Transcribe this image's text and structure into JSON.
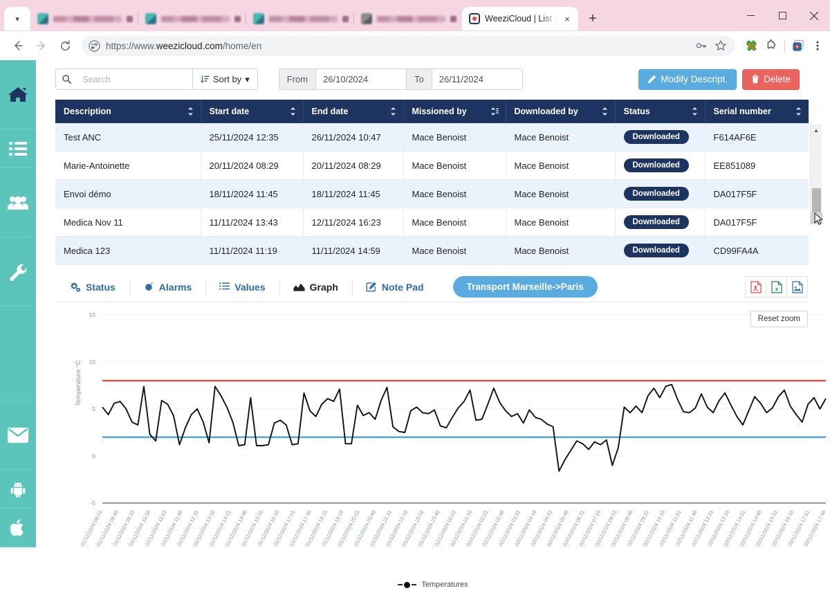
{
  "browser": {
    "tab_chevron_icon": "chevron-down-icon",
    "tabs": [
      {
        "title": "",
        "blurred": true
      },
      {
        "title": "",
        "blurred": true
      },
      {
        "title": "",
        "blurred": true
      },
      {
        "title": "",
        "blurred": true
      }
    ],
    "active_tab": {
      "title": "WeeziCloud | List of m",
      "favicon": "weezicloud-favicon",
      "close_label": "×"
    },
    "new_tab_label": "+",
    "window_controls": {
      "minimize": "—",
      "maximize": "□",
      "close": "✕"
    },
    "nav": {
      "back": "←",
      "forward": "→",
      "reload": "⟳"
    },
    "url_scheme": "https://www.",
    "url_host": "weezicloud.com",
    "url_path": "/home/en",
    "omnibox_icons": [
      "site-settings-icon",
      "password-key-icon",
      "bookmark-star-icon"
    ],
    "extension_icons": [
      "extension-5q-icon",
      "puzzle-extensions-icon",
      "profile-avatar-icon",
      "kebab-menu-icon"
    ]
  },
  "sidebar": {
    "items": [
      {
        "icon": "home-icon",
        "active": true
      },
      {
        "icon": "list-icon",
        "active": false
      },
      {
        "icon": "users-icon",
        "active": false
      },
      {
        "icon": "wrench-icon",
        "active": false
      },
      {
        "icon": "envelope-icon",
        "active": false
      },
      {
        "icon": "android-icon",
        "active": false
      },
      {
        "icon": "apple-icon",
        "active": false
      }
    ]
  },
  "toolbar": {
    "search_icon": "search-icon",
    "search_value": "",
    "search_placeholder": "Search",
    "sort_label": "Sort by",
    "sort_icon": "sort-icon",
    "sort_caret": "▾",
    "from_label": "From",
    "from_value": "26/10/2024",
    "to_label": "To",
    "to_value": "26/11/2024",
    "modify_label": "Modify Descript.",
    "modify_icon": "pencil-icon",
    "delete_label": "Delete",
    "delete_icon": "trash-icon",
    "accent_blue": "#5aabdf",
    "accent_red": "#e9645c"
  },
  "table": {
    "columns": [
      {
        "label": "Description",
        "sorted": false
      },
      {
        "label": "Start date",
        "sorted": false
      },
      {
        "label": "End date",
        "sorted": false
      },
      {
        "label": "Missioned by",
        "sorted": true
      },
      {
        "label": "Downloaded by",
        "sorted": false
      },
      {
        "label": "Status",
        "sorted": false
      },
      {
        "label": "Serial number",
        "sorted": false
      }
    ],
    "rows": [
      {
        "description": "Test ANC",
        "start": "25/11/2024 12:35",
        "end": "26/11/2024 10:47",
        "missioned": "Mace Benoist",
        "downloaded": "Mace Benoist",
        "status": "Downloaded",
        "serial": "F614AF6E"
      },
      {
        "description": "Marie-Antoinette",
        "start": "20/11/2024 08:29",
        "end": "20/11/2024 08:29",
        "missioned": "Mace Benoist",
        "downloaded": "Mace Benoist",
        "status": "Downloaded",
        "serial": "EE851089"
      },
      {
        "description": "Envoi démo",
        "start": "18/11/2024 11:45",
        "end": "18/11/2024 11:45",
        "missioned": "Mace Benoist",
        "downloaded": "Mace Benoist",
        "status": "Downloaded",
        "serial": "DA017F5F"
      },
      {
        "description": "Medica Nov 11",
        "start": "11/11/2024 13:43",
        "end": "12/11/2024 16:23",
        "missioned": "Mace Benoist",
        "downloaded": "Mace Benoist",
        "status": "Downloaded",
        "serial": "DA017F5F"
      },
      {
        "description": "Medica 123",
        "start": "11/11/2024 11:19",
        "end": "11/11/2024 14:59",
        "missioned": "Mace Benoist",
        "downloaded": "Mace Benoist",
        "status": "Downloaded",
        "serial": "CD99FA4A"
      }
    ],
    "header_bg": "#1d3461",
    "badge_bg": "#1d3461"
  },
  "detail_tabs": {
    "items": [
      {
        "label": "Status",
        "icon": "gears-icon",
        "active": false
      },
      {
        "label": "Alarms",
        "icon": "bell-icon",
        "active": false
      },
      {
        "label": "Values",
        "icon": "list-values-icon",
        "active": false
      },
      {
        "label": "Graph",
        "icon": "chart-icon",
        "active": true
      },
      {
        "label": "Note Pad",
        "icon": "notepad-edit-icon",
        "active": false
      }
    ],
    "mission_title": "Transport Marseille->Paris",
    "exports": [
      {
        "icon": "export-pdf-icon",
        "color": "#e8453c",
        "label": "PDF"
      },
      {
        "icon": "export-excel-icon",
        "color": "#1d8a4c",
        "label": "Excel"
      },
      {
        "icon": "export-image-icon",
        "color": "#2d6ca2",
        "label": "Image"
      }
    ]
  },
  "chart_controls": {
    "reset_zoom_label": "Reset zoom"
  },
  "chart_data": {
    "type": "line",
    "title": "",
    "xlabel": "",
    "ylabel": "Temperature °C",
    "ylim": [
      -5,
      15
    ],
    "yticks": [
      15,
      10,
      5,
      0,
      -5
    ],
    "grid": true,
    "legend_position": "bottom",
    "legend": [
      "Temperatures"
    ],
    "series": [
      {
        "name": "Temperatures",
        "color": "#111111",
        "values": [
          5.2,
          4.4,
          5.6,
          5.8,
          5.0,
          3.6,
          3.3,
          7.4,
          2.3,
          1.6,
          5.9,
          5.5,
          4.3,
          1.2,
          3.0,
          4.4,
          5.0,
          3.6,
          1.4,
          7.4,
          6.4,
          5.2,
          3.6,
          1.1,
          1.2,
          6.2,
          1.1,
          1.1,
          1.2,
          3.5,
          3.8,
          3.3,
          1.2,
          1.3,
          6.7,
          4.8,
          4.2,
          5.5,
          6.1,
          5.8,
          7.1,
          1.3,
          1.3,
          5.4,
          4.3,
          4.6,
          3.9,
          5.9,
          7.3,
          3.1,
          2.6,
          2.5,
          4.8,
          5.2,
          4.6,
          4.5,
          4.9,
          3.2,
          3.0,
          4.1,
          5.1,
          5.8,
          7.0,
          3.8,
          3.9,
          5.5,
          7.2,
          5.7,
          4.8,
          4.2,
          4.5,
          3.5,
          4.9,
          4.1,
          3.9,
          3.4,
          3.1,
          -1.6,
          -0.4,
          0.6,
          1.6,
          1.3,
          0.7,
          1.5,
          1.2,
          1.7,
          -1.0,
          0.9,
          5.2,
          4.6,
          5.3,
          4.6,
          6.4,
          7.2,
          6.2,
          7.4,
          7.6,
          6.0,
          4.7,
          4.6,
          5.1,
          6.6,
          5.2,
          4.6,
          5.9,
          6.7,
          5.4,
          4.2,
          3.3,
          4.8,
          6.3,
          5.6,
          4.6,
          5.1,
          6.3,
          7.0,
          5.3,
          4.4,
          3.6,
          5.5,
          6.2,
          5.0,
          6.1
        ]
      }
    ],
    "threshold_lines": [
      {
        "name": "high-threshold",
        "value": 8.0,
        "color": "#ef4a3f"
      },
      {
        "name": "low-threshold",
        "value": 2.0,
        "color": "#4ba3e3"
      }
    ],
    "xticks": [
      "01/11/2024 08:01",
      "01/11/2024 08:46",
      "01/11/2024 09:31",
      "01/11/2024 10:16",
      "01/11/2024 11:01",
      "01/11/2024 11:46",
      "01/11/2024 12:31",
      "01/11/2024 13:16",
      "01/11/2024 14:01",
      "01/11/2024 14:46",
      "01/11/2024 15:31",
      "01/11/2024 16:16",
      "01/11/2024 17:01",
      "01/11/2024 17:46",
      "01/11/2024 18:31",
      "01/11/2024 19:16",
      "01/11/2024 20:01",
      "01/11/2024 20:46",
      "01/11/2024 21:31",
      "01/11/2024 22:16",
      "01/11/2024 23:01",
      "01/11/2024 23:46",
      "02/11/2024 00:31",
      "02/11/2024 01:16",
      "02/11/2024 02:01",
      "02/11/2024 02:46",
      "02/11/2024 03:31",
      "02/11/2024 04:16",
      "02/11/2024 05:01",
      "02/11/2024 05:46",
      "02/11/2024 06:31",
      "02/11/2024 07:16",
      "02/11/2024 08:01",
      "02/11/2024 08:46",
      "02/11/2024 09:31",
      "02/11/2024 10:16",
      "02/11/2024 11:01",
      "02/11/2024 11:46",
      "02/11/2024 12:31",
      "02/11/2024 13:16",
      "02/11/2024 14:01",
      "02/11/2024 14:46",
      "02/11/2024 15:31",
      "02/11/2024 16:16",
      "02/11/2024 17:01",
      "02/11/2024 17:46"
    ]
  }
}
